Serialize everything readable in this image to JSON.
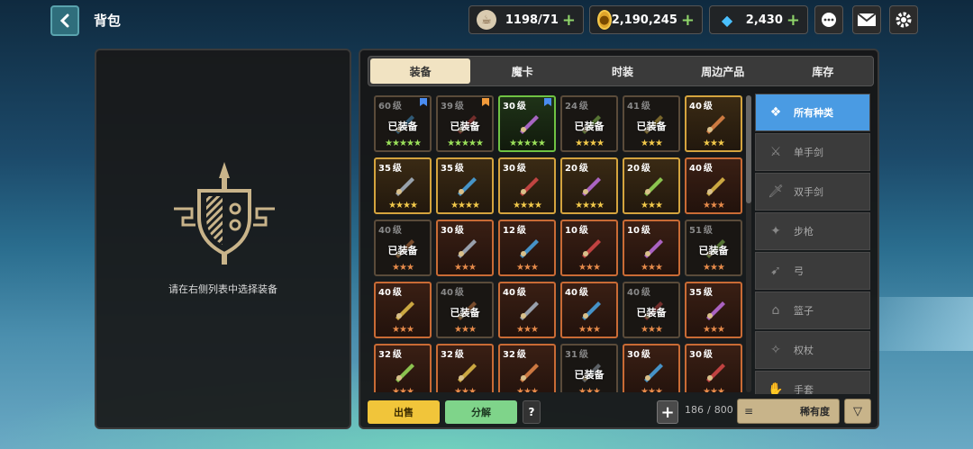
{
  "header": {
    "title": "背包",
    "resources": {
      "coffee": {
        "icon": "coffee-cup-icon",
        "value": "1198/71"
      },
      "gold": {
        "icon": "gold-coin-icon",
        "value": "2,190,245"
      },
      "gem": {
        "icon": "diamond-gem-icon",
        "value": "2,430"
      }
    },
    "icons": [
      "chat-bubble-icon",
      "mail-icon",
      "gear-icon"
    ]
  },
  "left_panel": {
    "hint": "请在右侧列表中选择装备"
  },
  "tabs": [
    {
      "label": "装备",
      "active": true
    },
    {
      "label": "魔卡",
      "active": false
    },
    {
      "label": "时装",
      "active": false
    },
    {
      "label": "周边产品",
      "active": false
    },
    {
      "label": "库存",
      "active": false
    }
  ],
  "grid_rows": [
    [
      {
        "level": "60",
        "unit": "级",
        "equipped": "已装备",
        "stars": "★★★★★",
        "rarity": "green",
        "flag": "blue",
        "dim": true,
        "icon": "dark-staff-icon"
      },
      {
        "level": "39",
        "unit": "级",
        "equipped": "已装备",
        "stars": "★★★★★",
        "rarity": "green",
        "flag": "orange",
        "dim": true,
        "icon": "lance-icon"
      },
      {
        "level": "30",
        "unit": "级",
        "equipped": "",
        "stars": "★★★★★",
        "rarity": "green",
        "flag": "blue",
        "dim": false,
        "icon": "drill-lance-icon"
      },
      {
        "level": "24",
        "unit": "级",
        "equipped": "已装备",
        "stars": "★★★★",
        "rarity": "gold",
        "flag": "",
        "dim": true,
        "icon": "halberd-icon"
      },
      {
        "level": "41",
        "unit": "级",
        "equipped": "已装备",
        "stars": "★★★",
        "rarity": "gold",
        "flag": "",
        "dim": true,
        "icon": "claw-icon"
      },
      {
        "level": "40",
        "unit": "级",
        "equipped": "",
        "stars": "★★★",
        "rarity": "gold",
        "flag": "",
        "dim": false,
        "icon": "red-sword-icon"
      }
    ],
    [
      {
        "level": "35",
        "unit": "级",
        "equipped": "",
        "stars": "★★★★",
        "rarity": "gold",
        "flag": "",
        "dim": false,
        "icon": "treasure-chest-icon"
      },
      {
        "level": "35",
        "unit": "级",
        "equipped": "",
        "stars": "★★★★",
        "rarity": "gold",
        "flag": "",
        "dim": false,
        "icon": "flower-icon"
      },
      {
        "level": "30",
        "unit": "级",
        "equipped": "",
        "stars": "★★★★",
        "rarity": "gold",
        "flag": "",
        "dim": false,
        "icon": "blue-staff-icon"
      },
      {
        "level": "20",
        "unit": "级",
        "equipped": "",
        "stars": "★★★★",
        "rarity": "gold",
        "flag": "",
        "dim": false,
        "icon": "purple-wings-icon"
      },
      {
        "level": "20",
        "unit": "级",
        "equipped": "",
        "stars": "★★★",
        "rarity": "gold",
        "flag": "",
        "dim": false,
        "icon": "purple-orb-icon"
      },
      {
        "level": "40",
        "unit": "级",
        "equipped": "",
        "stars": "★★★",
        "rarity": "orange",
        "flag": "",
        "dim": false,
        "icon": "glove-icon"
      }
    ],
    [
      {
        "level": "40",
        "unit": "级",
        "equipped": "已装备",
        "stars": "★★★",
        "rarity": "orange",
        "flag": "",
        "dim": true,
        "icon": "bow-icon"
      },
      {
        "level": "30",
        "unit": "级",
        "equipped": "",
        "stars": "★★★",
        "rarity": "orange",
        "flag": "",
        "dim": false,
        "icon": "green-ring-icon"
      },
      {
        "level": "12",
        "unit": "级",
        "equipped": "",
        "stars": "★★★",
        "rarity": "orange",
        "flag": "",
        "dim": false,
        "icon": "pink-gauntlet-icon"
      },
      {
        "level": "10",
        "unit": "级",
        "equipped": "",
        "stars": "★★★",
        "rarity": "orange",
        "flag": "",
        "dim": false,
        "icon": "purple-claw-icon"
      },
      {
        "level": "10",
        "unit": "级",
        "equipped": "",
        "stars": "★★★",
        "rarity": "orange",
        "flag": "",
        "dim": false,
        "icon": "mace-icon"
      },
      {
        "level": "51",
        "unit": "级",
        "equipped": "已装备",
        "stars": "★★★",
        "rarity": "orange",
        "flag": "",
        "dim": true,
        "icon": "green-amulet-icon"
      }
    ],
    [
      {
        "level": "40",
        "unit": "级",
        "equipped": "",
        "stars": "★★★",
        "rarity": "orange",
        "flag": "",
        "dim": false,
        "icon": "flame-blade-icon"
      },
      {
        "level": "40",
        "unit": "级",
        "equipped": "已装备",
        "stars": "★★★",
        "rarity": "orange",
        "flag": "",
        "dim": true,
        "icon": "empty-slot-icon"
      },
      {
        "level": "40",
        "unit": "级",
        "equipped": "",
        "stars": "★★★",
        "rarity": "orange",
        "flag": "",
        "dim": false,
        "icon": "green-boots-icon"
      },
      {
        "level": "40",
        "unit": "级",
        "equipped": "",
        "stars": "★★★",
        "rarity": "orange",
        "flag": "",
        "dim": false,
        "icon": "ice-claw-icon"
      },
      {
        "level": "40",
        "unit": "级",
        "equipped": "已装备",
        "stars": "★★★",
        "rarity": "orange",
        "flag": "",
        "dim": true,
        "icon": "dark-helm-icon"
      },
      {
        "level": "35",
        "unit": "级",
        "equipped": "",
        "stars": "★★★",
        "rarity": "orange",
        "flag": "",
        "dim": false,
        "icon": "purple-blade-icon"
      }
    ],
    [
      {
        "level": "32",
        "unit": "级",
        "equipped": "",
        "stars": "★★★",
        "rarity": "orange",
        "flag": "",
        "dim": false,
        "icon": "rifle-icon"
      },
      {
        "level": "32",
        "unit": "级",
        "equipped": "",
        "stars": "★★★",
        "rarity": "orange",
        "flag": "",
        "dim": false,
        "icon": "red-armor-icon"
      },
      {
        "level": "32",
        "unit": "级",
        "equipped": "",
        "stars": "★★★",
        "rarity": "orange",
        "flag": "",
        "dim": false,
        "icon": "silver-shield-icon"
      },
      {
        "level": "31",
        "unit": "级",
        "equipped": "已装备",
        "stars": "★★★",
        "rarity": "orange",
        "flag": "",
        "dim": true,
        "icon": "dark-bow-icon"
      },
      {
        "level": "30",
        "unit": "级",
        "equipped": "",
        "stars": "★★★",
        "rarity": "orange",
        "flag": "",
        "dim": false,
        "icon": "red-bow-icon"
      },
      {
        "level": "30",
        "unit": "级",
        "equipped": "",
        "stars": "★★★",
        "rarity": "orange",
        "flag": "",
        "dim": false,
        "icon": "red-gauntlet-icon"
      }
    ]
  ],
  "categories": [
    {
      "label": "所有种类",
      "active": true,
      "icon": "all-types-icon",
      "glyph": "❖"
    },
    {
      "label": "单手剑",
      "active": false,
      "icon": "one-hand-sword-icon",
      "glyph": "⚔"
    },
    {
      "label": "双手剑",
      "active": false,
      "icon": "two-hand-sword-icon",
      "glyph": "🗡"
    },
    {
      "label": "步枪",
      "active": false,
      "icon": "rifle-icon",
      "glyph": "✦"
    },
    {
      "label": "弓",
      "active": false,
      "icon": "bow-icon",
      "glyph": "➹"
    },
    {
      "label": "篮子",
      "active": false,
      "icon": "basket-icon",
      "glyph": "⌂"
    },
    {
      "label": "权杖",
      "active": false,
      "icon": "staff-icon",
      "glyph": "✧"
    },
    {
      "label": "手套",
      "active": false,
      "icon": "gauntlet-icon",
      "glyph": "✋"
    }
  ],
  "bottom": {
    "sell": "出售",
    "dismantle": "分解",
    "help": "?",
    "add": "+",
    "capacity_used": "186",
    "capacity_sep": "/",
    "capacity_max": "800",
    "sort_label": "稀有度",
    "sort_dir": "▽"
  },
  "colors": {
    "accent_blue": "#4a9be3",
    "sell_yellow": "#f1c53a",
    "dismantle_green": "#7fd48a",
    "tab_active": "#f1e3c2"
  }
}
